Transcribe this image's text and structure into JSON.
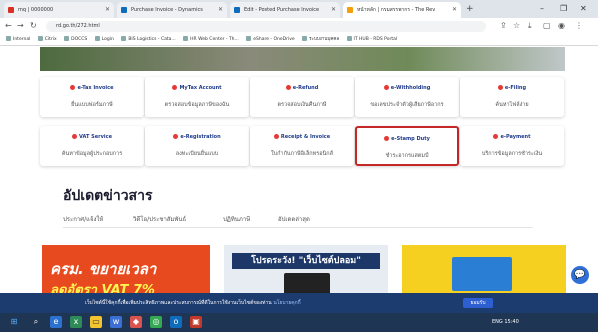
{
  "browser": {
    "tabs": [
      {
        "title": "mq | 0000000",
        "color": "#d93025",
        "active": false
      },
      {
        "title": "Purchase Invoice - Dynamics",
        "color": "#0f6cbd",
        "active": false
      },
      {
        "title": "Edit - Posted Purchase Invoice",
        "color": "#0f6cbd",
        "active": false
      },
      {
        "title": "หน้าหลัก | กรมสรรพากร - The Rev",
        "color": "#f59e0b",
        "active": true
      }
    ],
    "new_tab": "+",
    "address": "rd.go.th/272.html",
    "bookmarks": [
      "Internal",
      "Citrix",
      "DOCCS",
      "Login",
      "BIS Logistics - Cata...",
      "HR Web Center - Th...",
      "eShare - OneDrive",
      "ระบบงานบุคคล",
      "IT HUB - RDS Portal"
    ]
  },
  "hero_banner": {
    "label": ""
  },
  "services_row1": [
    {
      "logo": "e-Tax Invoice",
      "label": "ยื่นแบบฟอร์มภาษี"
    },
    {
      "logo": "MyTax Account",
      "label": "ตรวจสอบข้อมูลภาษีของฉัน"
    },
    {
      "logo": "e-Refund",
      "label": "ตรวจสอบเงินคืนภาษี"
    },
    {
      "logo": "e-Withholding",
      "label": "ขอเลขประจำตัวผู้เสียภาษีอากร"
    },
    {
      "logo": "e-Filing",
      "label": "ค้นหาไฟล์ง่าย"
    }
  ],
  "services_row2": [
    {
      "logo": "VAT Service",
      "label": "ค้นหาข้อมูลผู้ประกอบการ"
    },
    {
      "logo": "e-Registration",
      "label": "ลงทะเบียนยื่นแบบ"
    },
    {
      "logo": "Receipt & Invoice",
      "label": "ใบกำกับภาษีอิเล็กทรอนิกส์"
    },
    {
      "logo": "e-Stamp Duty",
      "label": "ชำระอากรแสตมป์"
    },
    {
      "logo": "e-Payment",
      "label": "บริการข้อมูลการชำระเงิน"
    }
  ],
  "news": {
    "title": "อัปเดตข่าวสาร",
    "tabs": [
      "ประกาศ/แจ้งให้",
      "วิดีโอ/ประชาสัมพันธ์",
      "ปฏิทินภาษี",
      "อัปเดตล่าสุด"
    ]
  },
  "promos": {
    "p1_line1": "ครม. ขยายเวลา",
    "p1_line2": "ลดอัตรา VAT 7%",
    "p2_title": "โปรดระวัง! \"เว็บไซต์ปลอม\""
  },
  "cookie_banner": {
    "text": "เว็บไซต์นี้ใช้คุกกี้เพื่อเพิ่มประสิทธิภาพและประสบการณ์ที่ดีในการใช้งานเว็บไซต์ของท่าน",
    "link": "นโยบายคุกกี้",
    "accept": "ยอมรับ"
  },
  "chat_icon": "chat-bubble-icon",
  "taskbar": {
    "tray_text": "ENG  15:40"
  }
}
